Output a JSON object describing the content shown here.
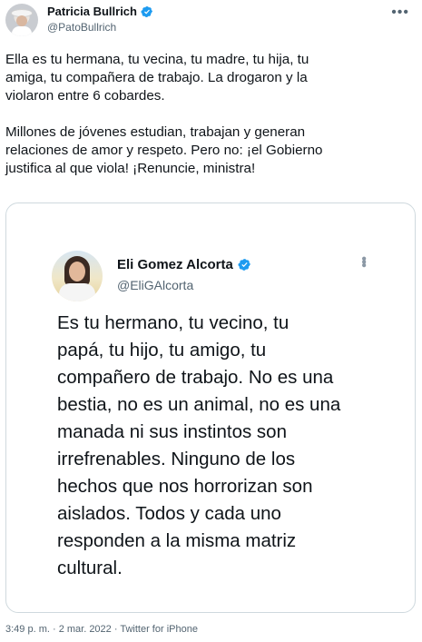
{
  "tweet": {
    "author": {
      "display_name": "Patricia Bullrich",
      "handle": "@PatoBullrich",
      "verified": true
    },
    "text": "Ella es tu hermana, tu vecina, tu madre, tu hija, tu\namiga, tu compañera de trabajo. La drogaron y la\nviolaron entre 6 cobardes.\n\nMillones de jóvenes estudian, trabajan y generan\nrelaciones de amor y respeto. Pero no: ¡el Gobierno\njustifica al que viola! ¡Renuncie, ministra!",
    "more_icon": "more-horizontal-icon",
    "timestamp": "3:49 p. m. · 2 mar. 2022 · Twitter for iPhone"
  },
  "embedded": {
    "author": {
      "display_name": "Eli Gomez Alcorta",
      "handle": "@EliGAlcorta",
      "verified": true
    },
    "text": "Es tu hermano, tu vecino, tu\npapá, tu hijo, tu amigo, tu\ncompañero de trabajo. No es una\nbestia, no es un animal, no es una\nmanada ni sus instintos son\nirrefrenables. Ninguno de los\nhechos que nos horrorizan son\naislados. Todos y cada uno\nresponden a la misma matriz\ncultural.",
    "more_icon": "more-vertical-icon"
  },
  "colors": {
    "text_primary": "#0f1419",
    "text_secondary": "#536471",
    "verified_blue": "#1d9bf0",
    "border": "#cfd9de"
  }
}
